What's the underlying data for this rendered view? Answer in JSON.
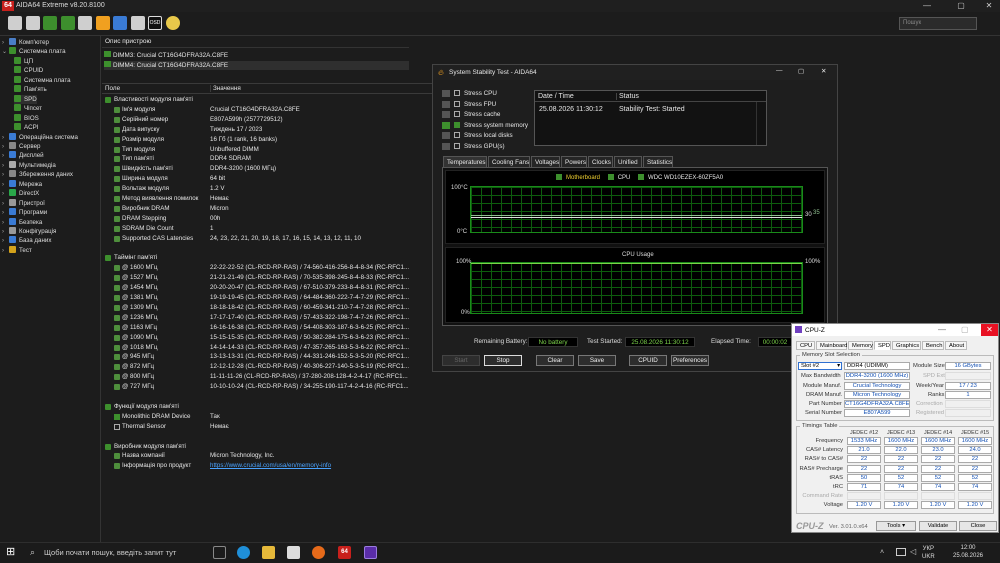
{
  "colors": {
    "accent_green": "#3d8f2d",
    "logo_red": "#c8201c",
    "graph_green": "#1a8a1a",
    "link_blue": "#4aa3ff"
  },
  "main_window": {
    "logo_text": "64",
    "title": "AIDA64 Extreme v8.20.8100",
    "search_placeholder": "Пошук"
  },
  "toolbar_icons": [
    "refresh-icon",
    "report-icon",
    "motherboard-icon",
    "memory-icon",
    "tools-icon",
    "flame-icon",
    "network-icon",
    "users-icon",
    "osd-icon",
    "clock-icon"
  ],
  "toolbar_osd_label": "OSD",
  "tree": [
    {
      "label": "Комп'ютер",
      "level": 0,
      "expanded": false,
      "icon_color": "#4a7ec7"
    },
    {
      "label": "Системна плата",
      "level": 0,
      "expanded": true,
      "icon_color": "#3d8f2d"
    },
    {
      "label": "ЦП",
      "level": 1,
      "icon_color": "#3d8f2d"
    },
    {
      "label": "CPUID",
      "level": 1,
      "icon_color": "#3d8f2d"
    },
    {
      "label": "Системна плата",
      "level": 1,
      "icon_color": "#3d8f2d"
    },
    {
      "label": "Пам'ять",
      "level": 1,
      "icon_color": "#3d8f2d"
    },
    {
      "label": "SPD",
      "level": 1,
      "icon_color": "#3d8f2d",
      "selected": true
    },
    {
      "label": "Чіпсет",
      "level": 1,
      "icon_color": "#3d8f2d"
    },
    {
      "label": "BIOS",
      "level": 1,
      "icon_color": "#3d8f2d"
    },
    {
      "label": "ACPI",
      "level": 1,
      "icon_color": "#3d8f2d"
    },
    {
      "label": "Операційна система",
      "level": 0,
      "expanded": false,
      "icon_color": "#3a7bd5"
    },
    {
      "label": "Сервер",
      "level": 0,
      "expanded": false,
      "icon_color": "#888"
    },
    {
      "label": "Дисплей",
      "level": 0,
      "expanded": false,
      "icon_color": "#3a7bd5"
    },
    {
      "label": "Мультимедіа",
      "level": 0,
      "expanded": false,
      "icon_color": "#aaa"
    },
    {
      "label": "Збереження даних",
      "level": 0,
      "expanded": false,
      "icon_color": "#888"
    },
    {
      "label": "Мережа",
      "level": 0,
      "expanded": false,
      "icon_color": "#3a7bd5"
    },
    {
      "label": "DirectX",
      "level": 0,
      "expanded": false,
      "icon_color": "#2aa84a"
    },
    {
      "label": "Пристрої",
      "level": 0,
      "expanded": false,
      "icon_color": "#999"
    },
    {
      "label": "Програми",
      "level": 0,
      "expanded": false,
      "icon_color": "#3a7bd5"
    },
    {
      "label": "Безпека",
      "level": 0,
      "expanded": false,
      "icon_color": "#3a7bd5"
    },
    {
      "label": "Конфігурація",
      "level": 0,
      "expanded": false,
      "icon_color": "#999"
    },
    {
      "label": "База даних",
      "level": 0,
      "expanded": false,
      "icon_color": "#3a7bd5"
    },
    {
      "label": "Тест",
      "level": 0,
      "expanded": false,
      "icon_color": "#d3a21b"
    }
  ],
  "device_panel": {
    "header": "Опис пристрою",
    "items": [
      "DIMM3: Crucial CT16G4DFRA32A.C8FE",
      "DIMM4: Crucial CT16G4DFRA32A.C8FE"
    ]
  },
  "columns": {
    "field": "Поле",
    "value": "Значення"
  },
  "rows": [
    {
      "type": "section",
      "k": "Властивості модуля пам'яті"
    },
    {
      "k": "Ім'я модуля",
      "v": "Crucial CT16G4DFRA32A.C8FE"
    },
    {
      "k": "Серійний номер",
      "v": "E807A599h (2577729512)"
    },
    {
      "k": "Дата випуску",
      "v": "Тиждень 17 / 2023"
    },
    {
      "k": "Розмір модуля",
      "v": "16 Гб (1 rank, 16 banks)"
    },
    {
      "k": "Тип модуля",
      "v": "Unbuffered DIMM"
    },
    {
      "k": "Тип пам'яті",
      "v": "DDR4 SDRAM"
    },
    {
      "k": "Швидкість пам'яті",
      "v": "DDR4-3200 (1600 МГц)"
    },
    {
      "k": "Ширина модуля",
      "v": "64 bit"
    },
    {
      "k": "Вольтаж модуля",
      "v": "1.2 V"
    },
    {
      "k": "Метод виявлення помилок",
      "v": "Немає"
    },
    {
      "k": "Виробник DRAM",
      "v": "Micron"
    },
    {
      "k": "DRAM Stepping",
      "v": "00h"
    },
    {
      "k": "SDRAM Die Count",
      "v": "1"
    },
    {
      "k": "Supported CAS Latencies",
      "v": "24, 23, 22, 21, 20, 19, 18, 17, 16, 15, 14, 13, 12, 11, 10"
    },
    {
      "type": "blank"
    },
    {
      "type": "section",
      "k": "Таймінг пам'яті"
    },
    {
      "k": "@ 1600 МГц",
      "v": "22-22-22-52  (CL-RCD-RP-RAS) / 74-560-416-256-8-4-8-34  (RC-RFC1..."
    },
    {
      "k": "@ 1527 МГц",
      "v": "21-21-21-49  (CL-RCD-RP-RAS) / 70-535-398-245-8-4-8-33  (RC-RFC1..."
    },
    {
      "k": "@ 1454 МГц",
      "v": "20-20-20-47  (CL-RCD-RP-RAS) / 67-510-379-233-8-4-8-31  (RC-RFC1..."
    },
    {
      "k": "@ 1381 МГц",
      "v": "19-19-19-45  (CL-RCD-RP-RAS) / 64-484-360-222-7-4-7-29  (RC-RFC1..."
    },
    {
      "k": "@ 1309 МГц",
      "v": "18-18-18-42  (CL-RCD-RP-RAS) / 60-459-341-210-7-4-7-28  (RC-RFC1..."
    },
    {
      "k": "@ 1236 МГц",
      "v": "17-17-17-40  (CL-RCD-RP-RAS) / 57-433-322-198-7-4-7-26  (RC-RFC1..."
    },
    {
      "k": "@ 1163 МГц",
      "v": "16-16-16-38  (CL-RCD-RP-RAS) / 54-408-303-187-6-3-6-25  (RC-RFC1..."
    },
    {
      "k": "@ 1090 МГц",
      "v": "15-15-15-35  (CL-RCD-RP-RAS) / 50-382-284-175-6-3-6-23  (RC-RFC1..."
    },
    {
      "k": "@ 1018 МГц",
      "v": "14-14-14-33  (CL-RCD-RP-RAS) / 47-357-265-163-5-3-6-22  (RC-RFC1..."
    },
    {
      "k": "@ 945 МГц",
      "v": "13-13-13-31  (CL-RCD-RP-RAS) / 44-331-246-152-5-3-5-20  (RC-RFC1..."
    },
    {
      "k": "@ 872 МГц",
      "v": "12-12-12-28  (CL-RCD-RP-RAS) / 40-306-227-140-5-3-5-19  (RC-RFC1..."
    },
    {
      "k": "@ 800 МГц",
      "v": "11-11-11-26  (CL-RCD-RP-RAS) / 37-280-208-128-4-2-4-17  (RC-RFC1..."
    },
    {
      "k": "@ 727 МГц",
      "v": "10-10-10-24  (CL-RCD-RP-RAS) / 34-255-190-117-4-2-4-16  (RC-RFC1..."
    },
    {
      "type": "blank"
    },
    {
      "type": "section",
      "k": "Функції модуля пам'яті"
    },
    {
      "type": "check",
      "checked": true,
      "k": "Monolithic DRAM Device",
      "v": "Так"
    },
    {
      "type": "check",
      "checked": false,
      "k": "Thermal Sensor",
      "v": "Немає"
    },
    {
      "type": "blank"
    },
    {
      "type": "section",
      "k": "Виробник модуля пам'яті"
    },
    {
      "k": "Назва компанії",
      "v": "Micron Technology, Inc."
    },
    {
      "k": "Інформація про продукт",
      "v": "https://www.crucial.com/usa/en/memory-info",
      "link": true
    }
  ],
  "stability": {
    "title": "System Stability Test - AIDA64",
    "checks": [
      {
        "label": "Stress CPU",
        "checked": false
      },
      {
        "label": "Stress FPU",
        "checked": false
      },
      {
        "label": "Stress cache",
        "checked": false
      },
      {
        "label": "Stress system memory",
        "checked": true
      },
      {
        "label": "Stress local disks",
        "checked": false
      },
      {
        "label": "Stress GPU(s)",
        "checked": false
      }
    ],
    "status_header": {
      "date": "Date / Time",
      "status": "Status"
    },
    "status_row": {
      "date": "25.08.2026 11:30:12",
      "status": "Stability Test: Started"
    },
    "tabs": [
      "Temperatures",
      "Cooling Fans",
      "Voltages",
      "Powers",
      "Clocks",
      "Unified",
      "Statistics"
    ],
    "legend": [
      "Motherboard",
      "CPU",
      "WDC WD10EZEX-60ZF5A0"
    ],
    "temp_top": "100°C",
    "temp_bottom": "0°C",
    "temp_right_value": "30",
    "temp_right_value2": "35",
    "usage_title": "CPU Usage",
    "usage_top_left": "100%",
    "usage_top_right": "100%",
    "usage_bottom": "0%",
    "remaining_label": "Remaining Battery:",
    "remaining_value": "No battery",
    "started_label": "Test Started:",
    "started_value": "25.08.2026 11:30:12",
    "elapsed_label": "Elapsed Time:",
    "elapsed_value": "00:00:02",
    "buttons": {
      "start": "Start",
      "stop": "Stop",
      "clear": "Clear",
      "save": "Save",
      "cpuid": "CPUID",
      "prefs": "Preferences"
    }
  },
  "cpuz": {
    "title": "CPU-Z",
    "tabs": [
      "CPU",
      "Mainboard",
      "Memory",
      "SPD",
      "Graphics",
      "Bench",
      "About"
    ],
    "group_slot": "Memory Slot Selection",
    "slot": "Slot #2",
    "mem_type": "DDR4 (UDIMM)",
    "module_size_label": "Module Size",
    "module_size": "16 GBytes",
    "max_bw_label": "Max Bandwidth",
    "max_bw": "DDR4-3200 (1600 MHz)",
    "spd_ext_label": "SPD Ext.",
    "manuf_label": "Module Manuf.",
    "manuf": "Crucial Technology",
    "week_label": "Week/Year",
    "week": "17 / 23",
    "dram_label": "DRAM Manuf.",
    "dram": "Micron Technology",
    "ranks_label": "Ranks",
    "ranks": "1",
    "part_label": "Part Number",
    "part": "CT16G4DFRA32A.C8FE",
    "correction_label": "Correction",
    "serial_label": "Serial Number",
    "serial": "E807A599",
    "registered_label": "Registered",
    "group_timings": "Timings Table",
    "jedec_headers": [
      "JEDEC #12",
      "JEDEC #13",
      "JEDEC #14",
      "JEDEC #15"
    ],
    "timing_rows": [
      {
        "label": "Frequency",
        "values": [
          "1533 MHz",
          "1600 MHz",
          "1600 MHz",
          "1600 MHz"
        ]
      },
      {
        "label": "CAS# Latency",
        "values": [
          "21.0",
          "22.0",
          "23.0",
          "24.0"
        ]
      },
      {
        "label": "RAS# to CAS#",
        "values": [
          "22",
          "22",
          "22",
          "22"
        ]
      },
      {
        "label": "RAS# Precharge",
        "values": [
          "22",
          "22",
          "22",
          "22"
        ]
      },
      {
        "label": "tRAS",
        "values": [
          "50",
          "52",
          "52",
          "52"
        ]
      },
      {
        "label": "tRC",
        "values": [
          "71",
          "74",
          "74",
          "74"
        ]
      },
      {
        "label": "Command Rate",
        "values": [
          "",
          "",
          "",
          ""
        ],
        "disabled": true
      },
      {
        "label": "Voltage",
        "values": [
          "1.20 V",
          "1.20 V",
          "1.20 V",
          "1.20 V"
        ]
      }
    ],
    "brand": "CPU-Z",
    "version": "Ver. 3.01.0.x64",
    "tools": "Tools",
    "validate": "Validate",
    "close": "Close"
  },
  "taskbar": {
    "search_placeholder": "Щоби почати пошук, введіть запит тут",
    "lang": "УКР",
    "lang2": "UKR",
    "time": "12:00",
    "date": "25.08.2026"
  }
}
